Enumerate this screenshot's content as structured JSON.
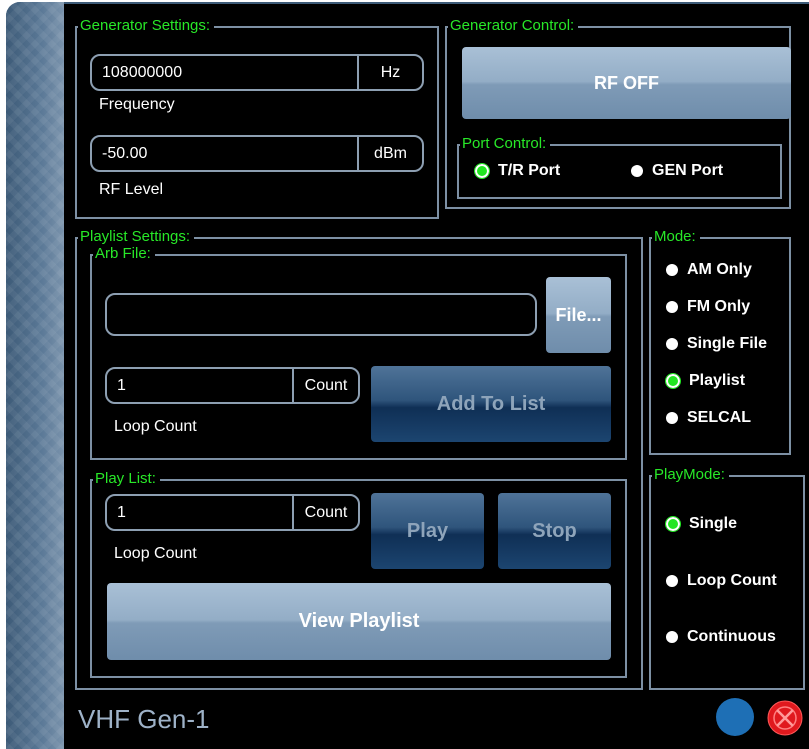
{
  "window_title": "VHF Gen-1",
  "generator_settings": {
    "title": "Generator Settings:",
    "frequency": {
      "value": "108000000",
      "unit": "Hz",
      "label": "Frequency"
    },
    "rf_level": {
      "value": "-50.00",
      "unit": "dBm",
      "label": "RF Level"
    }
  },
  "generator_control": {
    "title": "Generator Control:",
    "rf_button": "RF OFF",
    "port_control": {
      "title": "Port Control:",
      "options": [
        {
          "label": "T/R Port",
          "selected": true
        },
        {
          "label": "GEN Port",
          "selected": false
        }
      ]
    }
  },
  "playlist_settings": {
    "title": "Playlist Settings:",
    "arb_file": {
      "title": "Arb File:",
      "file_value": "",
      "file_button": "File...",
      "loop_value": "1",
      "loop_unit": "Count",
      "loop_label": "Loop Count",
      "add_button": "Add To List"
    },
    "play_list": {
      "title": "Play List:",
      "loop_value": "1",
      "loop_unit": "Count",
      "loop_label": "Loop Count",
      "play_button": "Play",
      "stop_button": "Stop",
      "view_button": "View Playlist"
    }
  },
  "mode": {
    "title": "Mode:",
    "options": [
      {
        "label": "AM Only",
        "selected": false
      },
      {
        "label": "FM Only",
        "selected": false
      },
      {
        "label": "Single File",
        "selected": false
      },
      {
        "label": "Playlist",
        "selected": true
      },
      {
        "label": "SELCAL",
        "selected": false
      }
    ]
  },
  "playmode": {
    "title": "PlayMode:",
    "options": [
      {
        "label": "Single",
        "selected": true
      },
      {
        "label": "Loop Count",
        "selected": false
      },
      {
        "label": "Continuous",
        "selected": false
      }
    ]
  },
  "colors": {
    "label_green": "#28e828",
    "status_blue": "#1e6fb5",
    "close_red": "#e0191e"
  },
  "icons": {
    "status": "status-circle-icon",
    "close": "close-x-icon"
  }
}
